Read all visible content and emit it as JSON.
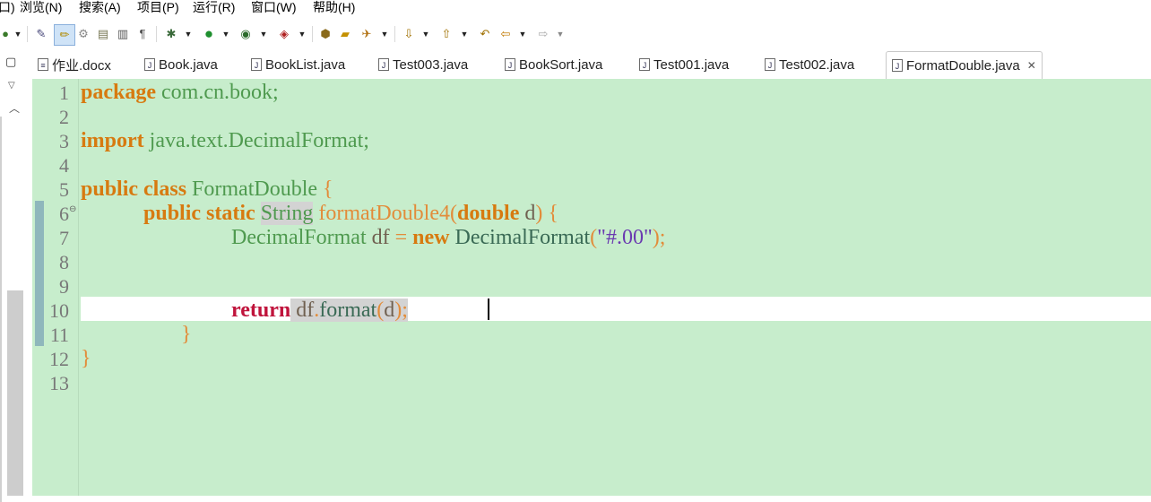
{
  "menu": [
    "口)",
    "浏览(N)",
    "搜索(A)",
    "项目(P)",
    "运行(R)",
    "窗口(W)",
    "帮助(H)"
  ],
  "tabs": [
    {
      "label": "作业.docx",
      "active": false
    },
    {
      "label": "Book.java",
      "active": false
    },
    {
      "label": "BookList.java",
      "active": false
    },
    {
      "label": "Test003.java",
      "active": false
    },
    {
      "label": "BookSort.java",
      "active": false
    },
    {
      "label": "Test001.java",
      "active": false
    },
    {
      "label": "Test002.java",
      "active": false
    },
    {
      "label": "FormatDouble.java",
      "active": true
    }
  ],
  "line_numbers": [
    "1",
    "2",
    "3",
    "4",
    "5",
    "6",
    "7",
    "8",
    "9",
    "10",
    "11",
    "12",
    "13"
  ],
  "code": {
    "l1_kw": "package",
    "l1_rest": " com.cn.book;",
    "l3_kw": "import",
    "l3_rest": " java.text.DecimalFormat;",
    "l5_kw": "public class",
    "l5_name": " FormatDouble ",
    "l5_brace": "{",
    "l6_kw": "public static",
    "l6_type": "String",
    "l6_method": "formatDouble4(",
    "l6_kw2": "double",
    "l6_var": " d",
    "l6_end": ") {",
    "l7_type": "DecimalFormat",
    "l7_var": " df",
    "l7_eq": " = ",
    "l7_kw": "new",
    "l7_cls": " DecimalFormat",
    "l7_open": "(",
    "l7_str": "\"#.00\"",
    "l7_close": ");",
    "l10_kw": "return",
    "l10_var": " df",
    "l10_dot": ".",
    "l10_m": "format",
    "l10_open": "(",
    "l10_arg": "d",
    "l10_close": ");",
    "l11": "}",
    "l12": "}"
  },
  "colors": {
    "editor_bg": "#c7edcc",
    "keyword": "#d77a10",
    "type": "#4f9a4f",
    "string": "#6a3ab0"
  },
  "icons": [
    "run-debug-icon",
    "run-icon",
    "external-tools-icon",
    "open-type-icon",
    "search-icon",
    "back-icon",
    "forward-icon"
  ]
}
